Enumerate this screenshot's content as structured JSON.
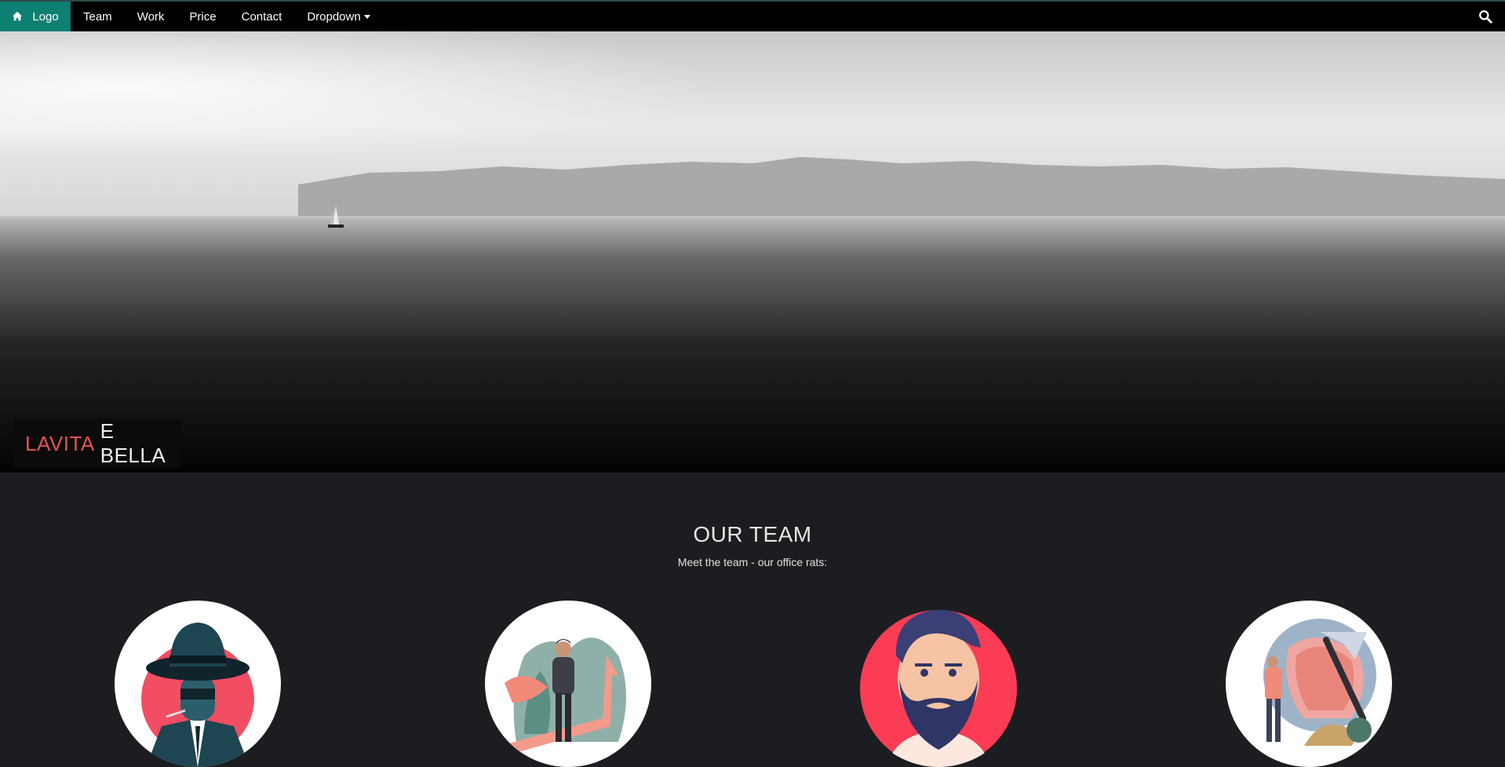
{
  "nav": {
    "logo_label": "Logo",
    "items": [
      "Team",
      "Work",
      "Price",
      "Contact",
      "Dropdown"
    ]
  },
  "hero": {
    "caption_accent": "LAVITA",
    "caption_rest": "E BELLA"
  },
  "team": {
    "title": "OUR TEAM",
    "subtitle": "Meet the team - our office rats:"
  },
  "colors": {
    "accent_teal": "#0e7f73",
    "accent_red": "#e55353",
    "section_bg": "#1c1d20"
  },
  "icons": {
    "home": "home-icon",
    "search": "search-icon"
  }
}
